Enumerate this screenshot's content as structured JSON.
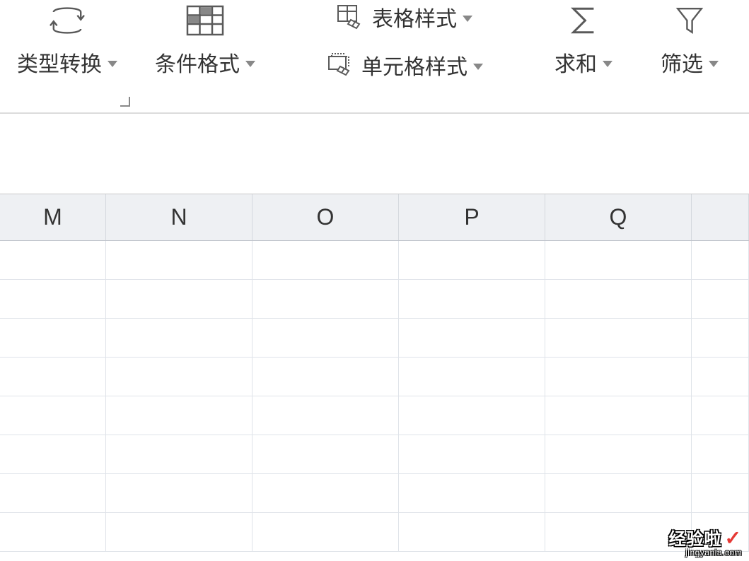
{
  "ribbon": {
    "type_convert": {
      "label": "类型转换"
    },
    "cond_format": {
      "label": "条件格式"
    },
    "table_style": {
      "label": "表格样式"
    },
    "cell_style": {
      "label": "单元格样式"
    },
    "sum": {
      "label": "求和"
    },
    "filter": {
      "label": "筛选"
    }
  },
  "columns": [
    "M",
    "N",
    "O",
    "P",
    "Q",
    ""
  ],
  "rows": 8,
  "watermark": {
    "brand": "经验啦",
    "url": "jingyanla.com"
  }
}
